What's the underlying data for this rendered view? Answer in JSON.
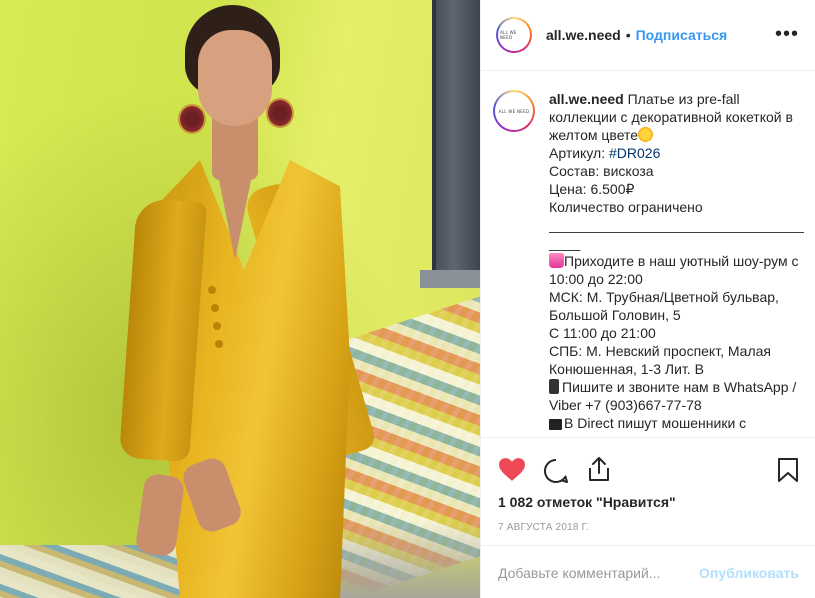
{
  "post": {
    "username": "all.we.need",
    "avatar_text": "ALL WE NEED",
    "dot": "•",
    "follow_label": "Подписаться",
    "more_label": "•••"
  },
  "caption": {
    "username": "all.we.need",
    "intro": "Платье из pre-fall коллекции с декоративной кокеткой в желтом цвете",
    "article_label": "Артикул: ",
    "article_tag": "#DR026",
    "composition": "Состав: вискоза",
    "price": "Цена: 6.500₽",
    "limited": "Количество ограничено",
    "divider": "____________________________________",
    "divider_tail": "____",
    "showroom": "Приходите в наш уютный шоу-рум с 10:00 до 22:00",
    "msk": "МСК: М. Трубная/Цветной бульвар, Большой Головин, 5",
    "msk_hours": "С 11:00 до 21:00",
    "spb": "СПБ: М. Невский проспект, Малая Конюшенная, 1-3 Лит. В",
    "contact": "Пишите и звоните нам в WhatsApp / Viber +7 (903)667-77-78",
    "direct": "В Direct пишут мошенники с"
  },
  "actions": {
    "like_icon": "heart-filled-icon",
    "comment_icon": "comment-icon",
    "share_icon": "share-icon",
    "save_icon": "bookmark-icon",
    "like_color": "#ed4956",
    "likes_text": "1 082 отметок \"Нравится\"",
    "date": "7 августа 2018 г."
  },
  "comment": {
    "placeholder": "Добавьте комментарий...",
    "publish_label": "Опубликовать"
  },
  "colors": {
    "link": "#3897f0",
    "hashtag": "#003569",
    "publish_disabled": "#b2dffc",
    "muted": "#999999"
  }
}
